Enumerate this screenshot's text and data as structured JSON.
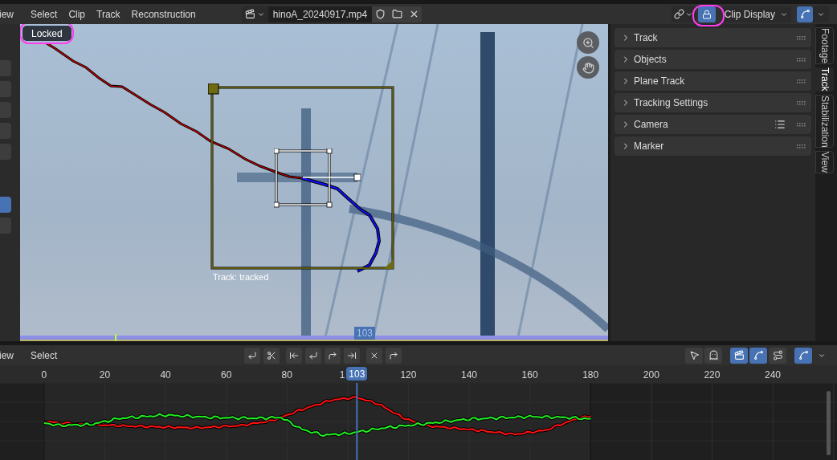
{
  "header": {
    "menus": [
      "iew",
      "Select",
      "Clip",
      "Track",
      "Reconstruction"
    ],
    "clip_name": "hinoA_20240917.mp4",
    "lock": {
      "selected": true
    },
    "display_menu": "Clip Display",
    "curve_toggle": {
      "selected": true
    }
  },
  "viewer": {
    "status": "Locked",
    "track_label": "Track: tracked",
    "current_frame": "103"
  },
  "sidebar": {
    "panels": [
      {
        "title": "Track",
        "expanded": false,
        "has_presets": false
      },
      {
        "title": "Objects",
        "expanded": false,
        "has_presets": false
      },
      {
        "title": "Plane Track",
        "expanded": false,
        "has_presets": false
      },
      {
        "title": "Tracking Settings",
        "expanded": false,
        "has_presets": false
      },
      {
        "title": "Camera",
        "expanded": false,
        "has_presets": true
      },
      {
        "title": "Marker",
        "expanded": false,
        "has_presets": false
      }
    ],
    "tabs": [
      {
        "label": "Footage",
        "selected": false
      },
      {
        "label": "Track",
        "selected": true
      },
      {
        "label": "Stabilization",
        "selected": false
      },
      {
        "label": "View",
        "selected": false
      }
    ]
  },
  "graph": {
    "menus": [
      "iew",
      "Select"
    ],
    "toggles": [
      {
        "kind": "pointer",
        "selected": false
      },
      {
        "kind": "ghost",
        "selected": false
      },
      {
        "kind": "clip",
        "selected": true
      },
      {
        "kind": "curve",
        "selected": true
      },
      {
        "kind": "route",
        "selected": false
      },
      {
        "kind": "view",
        "selected": true
      }
    ],
    "frame_ticks": [
      "0",
      "20",
      "40",
      "60",
      "80",
      "1",
      "120",
      "140",
      "160",
      "180",
      "200",
      "220",
      "240"
    ],
    "current_frame": "103"
  }
}
